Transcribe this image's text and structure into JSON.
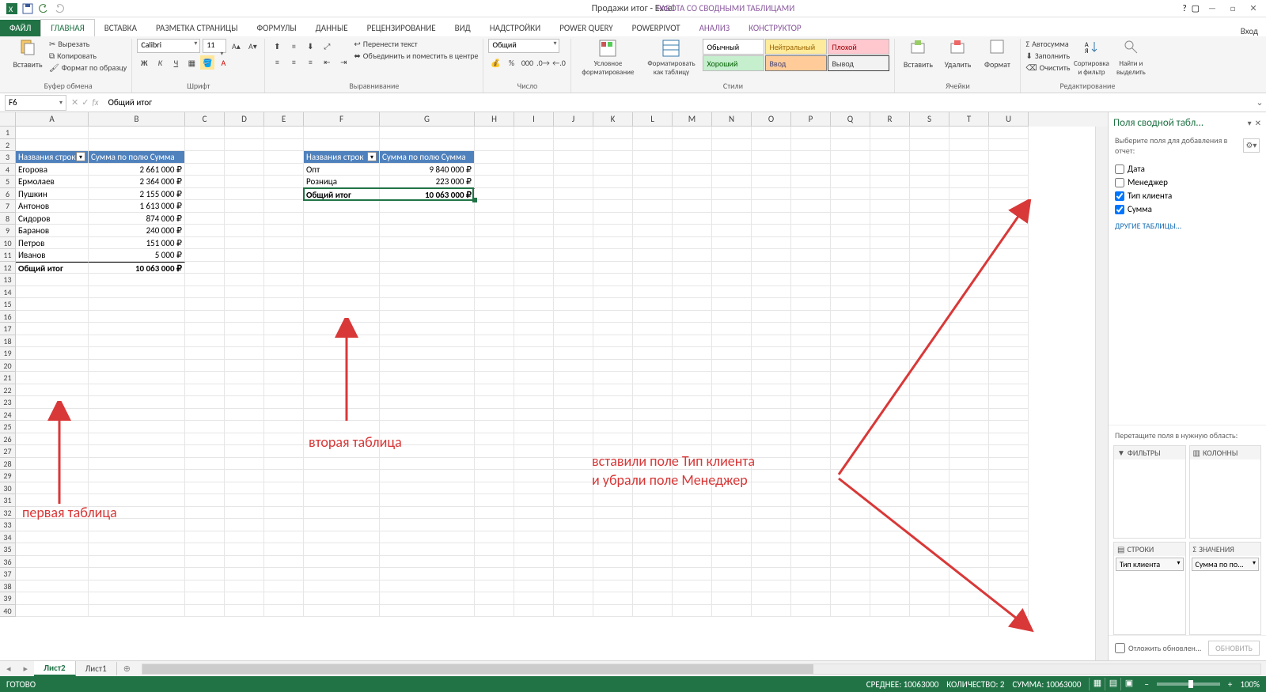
{
  "titlebar": {
    "title": "Продажи итог - Excel",
    "context": "РАБОТА СО СВОДНЫМИ ТАБЛИЦАМИ",
    "login": "Вход"
  },
  "tabs": {
    "file": "ФАЙЛ",
    "home": "ГЛАВНАЯ",
    "insert": "ВСТАВКА",
    "layout": "РАЗМЕТКА СТРАНИЦЫ",
    "formulas": "ФОРМУЛЫ",
    "data": "ДАННЫЕ",
    "review": "РЕЦЕНЗИРОВАНИЕ",
    "view": "ВИД",
    "addins": "НАДСТРОЙКИ",
    "pquery": "POWER QUERY",
    "ppivot": "POWERPIVOT",
    "analyze": "АНАЛИЗ",
    "design": "КОНСТРУКТОР"
  },
  "ribbon": {
    "clipboard": {
      "paste": "Вставить",
      "cut": "Вырезать",
      "copy": "Копировать",
      "format_painter": "Формат по образцу",
      "label": "Буфер обмена"
    },
    "font": {
      "name": "Calibri",
      "size": "11",
      "label": "Шрифт"
    },
    "align": {
      "wrap": "Перенести текст",
      "merge": "Объединить и поместить в центре",
      "label": "Выравнивание"
    },
    "number": {
      "format": "Общий",
      "label": "Число"
    },
    "styles": {
      "cond": "Условное форматирование",
      "table": "Форматировать как таблицу",
      "label": "Стили",
      "normal": "Обычный",
      "neutral": "Нейтральный",
      "bad": "Плохой",
      "good": "Хороший",
      "input": "Ввод",
      "output": "Вывод"
    },
    "cells": {
      "insert": "Вставить",
      "delete": "Удалить",
      "format": "Формат",
      "label": "Ячейки"
    },
    "editing": {
      "autosum": "Автосумма",
      "fill": "Заполнить",
      "clear": "Очистить",
      "sort": "Сортировка и фильтр",
      "find": "Найти и выделить",
      "label": "Редактирование"
    }
  },
  "formula_bar": {
    "cell_ref": "F6",
    "formula": "Общий итог"
  },
  "columns": [
    "A",
    "B",
    "C",
    "D",
    "E",
    "F",
    "G",
    "H",
    "I",
    "J",
    "K",
    "L",
    "M",
    "N",
    "O",
    "P",
    "Q",
    "R",
    "S",
    "T",
    "U"
  ],
  "col_widths": {
    "A": 92,
    "B": 122,
    "default": 50,
    "F": 96,
    "G": 120
  },
  "pivot1": {
    "hdr_rows": "Названия строк",
    "hdr_vals": "Сумма по полю Сумма",
    "rows": [
      [
        "Егорова",
        "2 661 000 ₽"
      ],
      [
        "Ермолаев",
        "2 364 000 ₽"
      ],
      [
        "Пушкин",
        "2 155 000 ₽"
      ],
      [
        "Антонов",
        "1 613 000 ₽"
      ],
      [
        "Сидоров",
        "874 000 ₽"
      ],
      [
        "Баранов",
        "240 000 ₽"
      ],
      [
        "Петров",
        "151 000 ₽"
      ],
      [
        "Иванов",
        "5 000 ₽"
      ]
    ],
    "total_label": "Общий итог",
    "total_val": "10 063 000 ₽"
  },
  "pivot2": {
    "hdr_rows": "Названия строк",
    "hdr_vals": "Сумма по полю Сумма",
    "rows": [
      [
        "Опт",
        "9 840 000 ₽"
      ],
      [
        "Розница",
        "223 000 ₽"
      ]
    ],
    "total_label": "Общий итог",
    "total_val": "10 063 000 ₽"
  },
  "annotations": {
    "t1": "первая таблица",
    "t2": "вторая таблица",
    "t3a": "вставили поле Тип клиента",
    "t3b": "и убрали поле Менеджер"
  },
  "fieldpane": {
    "title": "Поля сводной табл...",
    "subtitle": "Выберите поля для добавления в отчет:",
    "fields": [
      {
        "name": "Дата",
        "checked": false
      },
      {
        "name": "Менеджер",
        "checked": false
      },
      {
        "name": "Тип клиента",
        "checked": true
      },
      {
        "name": "Сумма",
        "checked": true
      }
    ],
    "other_tables": "ДРУГИЕ ТАБЛИЦЫ...",
    "drag_label": "Перетащите поля в нужную область:",
    "area_filters": "ФИЛЬТРЫ",
    "area_columns": "КОЛОННЫ",
    "area_rows": "СТРОКИ",
    "area_values": "ЗНАЧЕНИЯ",
    "row_chip": "Тип клиента",
    "val_chip": "Сумма по по...",
    "defer": "Отложить обновлен...",
    "update": "ОБНОВИТЬ"
  },
  "sheets": {
    "s1": "Лист2",
    "s2": "Лист1"
  },
  "statusbar": {
    "ready": "ГОТОВО",
    "avg": "СРЕДНЕЕ: 10063000",
    "count": "КОЛИЧЕСТВО: 2",
    "sum": "СУММА: 10063000",
    "zoom": "100%"
  }
}
